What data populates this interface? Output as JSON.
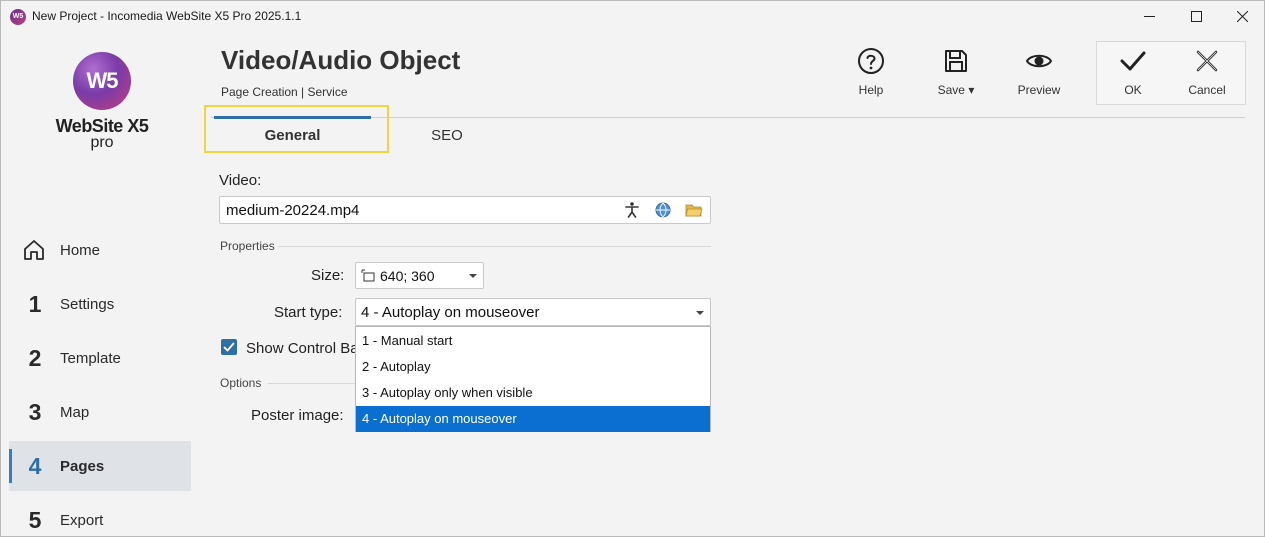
{
  "window": {
    "title": "New Project - Incomedia WebSite X5 Pro 2025.1.1",
    "app_icon_text": "W5",
    "controls": [
      "minimize-icon",
      "maximize-icon",
      "close-icon"
    ]
  },
  "logo": {
    "mark": "W5",
    "name": "WebSite X5",
    "edition": "pro"
  },
  "sidebar": {
    "items": [
      {
        "num": "",
        "icon": "home-icon",
        "label": "Home"
      },
      {
        "num": "1",
        "label": "Settings"
      },
      {
        "num": "2",
        "label": "Template"
      },
      {
        "num": "3",
        "label": "Map"
      },
      {
        "num": "4",
        "label": "Pages",
        "active": true
      },
      {
        "num": "5",
        "label": "Export"
      }
    ]
  },
  "header": {
    "title": "Video/Audio Object",
    "breadcrumb": "Page Creation | Service"
  },
  "toolbar": {
    "help": "Help",
    "save": "Save",
    "save_caret": "▾",
    "preview": "Preview",
    "ok": "OK",
    "cancel": "Cancel"
  },
  "tabs": [
    {
      "label": "General",
      "active": true
    },
    {
      "label": "SEO"
    }
  ],
  "form": {
    "video_label": "Video:",
    "video_value": "medium-20224.mp4",
    "video_icons": [
      "accessibility-icon",
      "globe-icon",
      "folder-icon"
    ],
    "properties_label": "Properties",
    "size_label": "Size:",
    "size_value": "640; 360",
    "start_type_label": "Start type:",
    "start_type_value": "4 - Autoplay on mouseover",
    "show_control_bar_label": "Show Control Ba",
    "show_control_bar_checked": true,
    "options_label": "Options",
    "poster_label": "Poster image:"
  },
  "dropdown": {
    "options": [
      "1 - Manual start",
      "2 - Autoplay",
      "3 - Autoplay only when visible",
      "4 - Autoplay on mouseover"
    ],
    "selected_index": 3
  },
  "colors": {
    "accent": "#2f6fa8",
    "selection": "#0a6fd0",
    "highlight_box": "#f0d540"
  }
}
